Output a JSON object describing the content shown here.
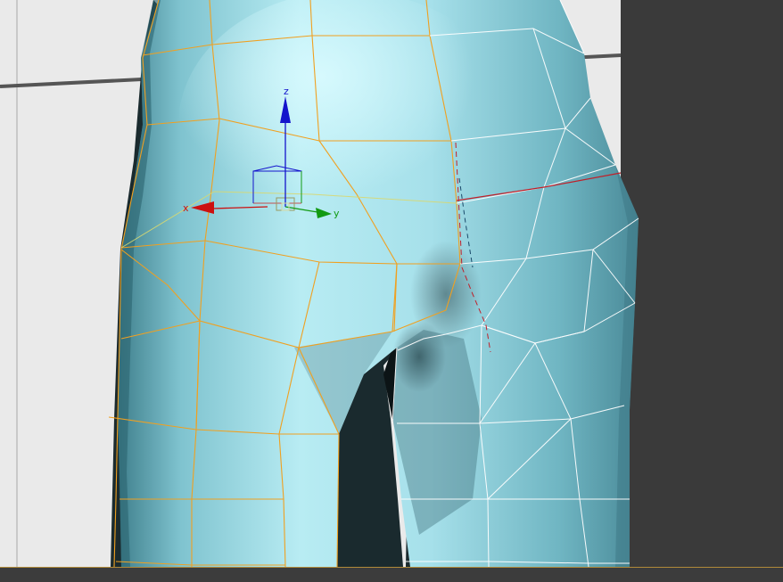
{
  "viewport": {
    "name": "perspective-viewport",
    "background_color": "#eaeaea",
    "side_panel_color": "#3a3a3a",
    "status_strip_color": "#3c3c3c",
    "status_strip_accent": "#b08a3a"
  },
  "model": {
    "name": "character-hips-mesh",
    "fill_color": "#9ed8e2",
    "highlight_color": "#c8f3fa",
    "shade_color": "#4e8e9c",
    "selected_wire_color": "#f0a020",
    "unselected_wire_color": "#ffffff",
    "symmetry_seam_color": "#c0202a"
  },
  "gizmo": {
    "name": "move-transform-gizmo",
    "axes": [
      {
        "key": "x",
        "label": "x",
        "color": "#cc1010"
      },
      {
        "key": "y",
        "label": "y",
        "color": "#129a12"
      },
      {
        "key": "z",
        "label": "z",
        "color": "#1414cc"
      }
    ]
  }
}
